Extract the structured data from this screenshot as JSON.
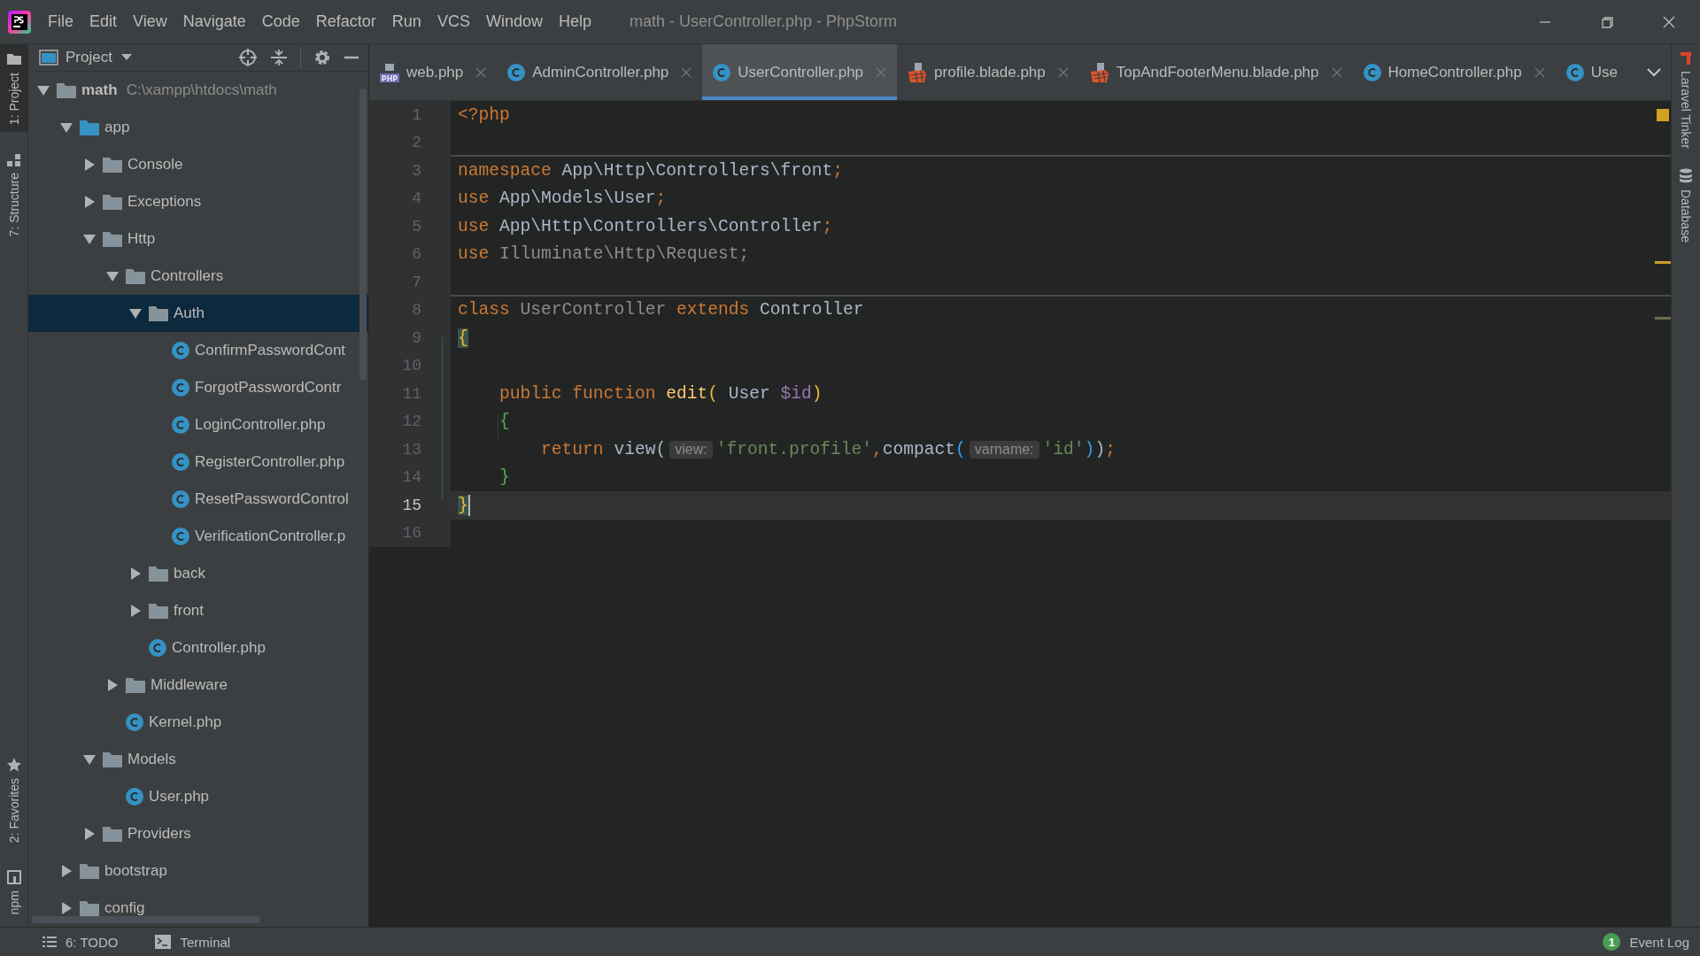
{
  "window": {
    "title": "math - UserController.php - PhpStorm"
  },
  "menu": [
    "File",
    "Edit",
    "View",
    "Navigate",
    "Code",
    "Refactor",
    "Run",
    "VCS",
    "Window",
    "Help"
  ],
  "left_tool_strip": {
    "top": [
      {
        "label": "1: Project",
        "selected": true
      },
      {
        "label": "7: Structure",
        "selected": false
      }
    ],
    "bottom": [
      {
        "label": "2: Favorites",
        "selected": false
      },
      {
        "label": "npm",
        "selected": false
      }
    ]
  },
  "project_panel": {
    "title": "Project",
    "tree": [
      {
        "label": "math",
        "path": "C:\\xampp\\htdocs\\math",
        "kind": "root",
        "expanded": true,
        "selected": false,
        "children": [
          {
            "label": "app",
            "kind": "source",
            "expanded": true,
            "selected": false,
            "children": [
              {
                "label": "Console",
                "kind": "folder",
                "expanded": false,
                "selected": false
              },
              {
                "label": "Exceptions",
                "kind": "folder",
                "expanded": false,
                "selected": false
              },
              {
                "label": "Http",
                "kind": "folder",
                "expanded": true,
                "selected": false,
                "children": [
                  {
                    "label": "Controllers",
                    "kind": "folder",
                    "expanded": true,
                    "selected": false,
                    "children": [
                      {
                        "label": "Auth",
                        "kind": "folder",
                        "expanded": true,
                        "selected": true,
                        "children": [
                          {
                            "label": "ConfirmPasswordCont",
                            "kind": "class",
                            "selected": false
                          },
                          {
                            "label": "ForgotPasswordContr",
                            "kind": "class",
                            "selected": false
                          },
                          {
                            "label": "LoginController.php",
                            "kind": "class",
                            "selected": false
                          },
                          {
                            "label": "RegisterController.php",
                            "kind": "class",
                            "selected": false
                          },
                          {
                            "label": "ResetPasswordControl",
                            "kind": "class",
                            "selected": false
                          },
                          {
                            "label": "VerificationController.p",
                            "kind": "class",
                            "selected": false
                          }
                        ]
                      },
                      {
                        "label": "back",
                        "kind": "folder",
                        "expanded": false,
                        "selected": false
                      },
                      {
                        "label": "front",
                        "kind": "folder",
                        "expanded": false,
                        "selected": false
                      },
                      {
                        "label": "Controller.php",
                        "kind": "class",
                        "selected": false
                      }
                    ]
                  },
                  {
                    "label": "Middleware",
                    "kind": "folder",
                    "expanded": false,
                    "selected": false
                  },
                  {
                    "label": "Kernel.php",
                    "kind": "class",
                    "selected": false
                  }
                ]
              },
              {
                "label": "Models",
                "kind": "folder",
                "expanded": true,
                "selected": false,
                "children": [
                  {
                    "label": "User.php",
                    "kind": "class",
                    "selected": false
                  }
                ]
              },
              {
                "label": "Providers",
                "kind": "folder",
                "expanded": false,
                "selected": false
              }
            ]
          },
          {
            "label": "bootstrap",
            "kind": "folder",
            "expanded": false,
            "selected": false
          },
          {
            "label": "config",
            "kind": "folder",
            "expanded": false,
            "selected": false
          }
        ]
      }
    ]
  },
  "tabs": [
    {
      "label": "web.php",
      "kind": "script",
      "icon_label": "PHP",
      "selected": false,
      "closable": true
    },
    {
      "label": "AdminController.php",
      "kind": "class",
      "selected": false,
      "closable": true
    },
    {
      "label": "UserController.php",
      "kind": "class",
      "selected": true,
      "closable": true
    },
    {
      "label": "profile.blade.php",
      "kind": "template",
      "selected": false,
      "closable": true
    },
    {
      "label": "TopAndFooterMenu.blade.php",
      "kind": "template",
      "selected": false,
      "closable": true
    },
    {
      "label": "HomeController.php",
      "kind": "class",
      "selected": false,
      "closable": true
    },
    {
      "label": "Use",
      "kind": "class",
      "selected": false,
      "closable": false
    }
  ],
  "editor": {
    "lines": [
      {
        "number": "1",
        "current": false,
        "tokens": [
          {
            "text": "<?php",
            "kind": "keyword"
          }
        ]
      },
      {
        "number": "2",
        "current": false,
        "separator": true
      },
      {
        "number": "3",
        "current": false,
        "tokens": [
          {
            "text": "namespace ",
            "kind": "keyword"
          },
          {
            "text": "App\\Http\\Controllers\\front",
            "kind": "plain"
          },
          {
            "text": ";",
            "kind": "keyword"
          }
        ]
      },
      {
        "number": "4",
        "current": false,
        "tokens": [
          {
            "text": "use ",
            "kind": "keyword"
          },
          {
            "text": "App\\Models\\User",
            "kind": "plain"
          },
          {
            "text": ";",
            "kind": "keyword"
          }
        ]
      },
      {
        "number": "5",
        "current": false,
        "tokens": [
          {
            "text": "use ",
            "kind": "keyword"
          },
          {
            "text": "App\\Http\\Controllers\\Controller",
            "kind": "plain"
          },
          {
            "text": ";",
            "kind": "keyword"
          }
        ]
      },
      {
        "number": "6",
        "current": false,
        "tokens": [
          {
            "text": "use ",
            "kind": "keyword"
          },
          {
            "text": "Illuminate\\Http\\Request;",
            "kind": "unused"
          }
        ]
      },
      {
        "number": "7",
        "current": false,
        "separator": true
      },
      {
        "number": "8",
        "current": false,
        "tokens": [
          {
            "text": "class ",
            "kind": "keyword"
          },
          {
            "text": "UserController ",
            "kind": "unused"
          },
          {
            "text": "extends ",
            "kind": "keyword"
          },
          {
            "text": "Controller",
            "kind": "plain"
          }
        ]
      },
      {
        "number": "9",
        "current": false,
        "tokens": [
          {
            "text": "{",
            "kind": "bracket1",
            "matched": true
          }
        ]
      },
      {
        "number": "10",
        "current": false
      },
      {
        "number": "11",
        "current": false,
        "tokens": [
          {
            "text": "    public function ",
            "kind": "keyword"
          },
          {
            "text": "edit",
            "kind": "function"
          },
          {
            "text": "(",
            "kind": "bracket1"
          },
          {
            "text": " User ",
            "kind": "plain"
          },
          {
            "text": "$id",
            "kind": "variable"
          },
          {
            "text": ")",
            "kind": "bracket1"
          }
        ]
      },
      {
        "number": "12",
        "current": false,
        "tokens": [
          {
            "text": "    {",
            "kind": "bracket2"
          }
        ]
      },
      {
        "number": "13",
        "current": false,
        "tokens": [
          {
            "text": "        return ",
            "kind": "keyword"
          },
          {
            "text": "view",
            "kind": "plain"
          },
          {
            "text": "(",
            "kind": "plain"
          },
          {
            "text": "view:",
            "kind": "hint"
          },
          {
            "text": "'front.profile'",
            "kind": "string"
          },
          {
            "text": ",",
            "kind": "keyword"
          },
          {
            "text": "compact",
            "kind": "plain"
          },
          {
            "text": "(",
            "kind": "bracket3"
          },
          {
            "text": "varname:",
            "kind": "hint"
          },
          {
            "text": "'id'",
            "kind": "string"
          },
          {
            "text": ")",
            "kind": "bracket3"
          },
          {
            "text": ")",
            "kind": "plain"
          },
          {
            "text": ";",
            "kind": "keyword"
          }
        ]
      },
      {
        "number": "14",
        "current": false,
        "tokens": [
          {
            "text": "    }",
            "kind": "bracket2"
          }
        ]
      },
      {
        "number": "15",
        "current": true,
        "tokens": [
          {
            "text": "}",
            "kind": "bracket1",
            "matched": true
          }
        ]
      },
      {
        "number": "16",
        "current": false
      }
    ]
  },
  "right_tool_strip": [
    {
      "label": "Laravel Tinker"
    },
    {
      "label": "Database"
    }
  ],
  "status_bar": {
    "left": [
      {
        "label": "6: TODO"
      },
      {
        "label": "Terminal"
      }
    ],
    "event_log": {
      "count": "1",
      "label": "Event Log"
    }
  }
}
